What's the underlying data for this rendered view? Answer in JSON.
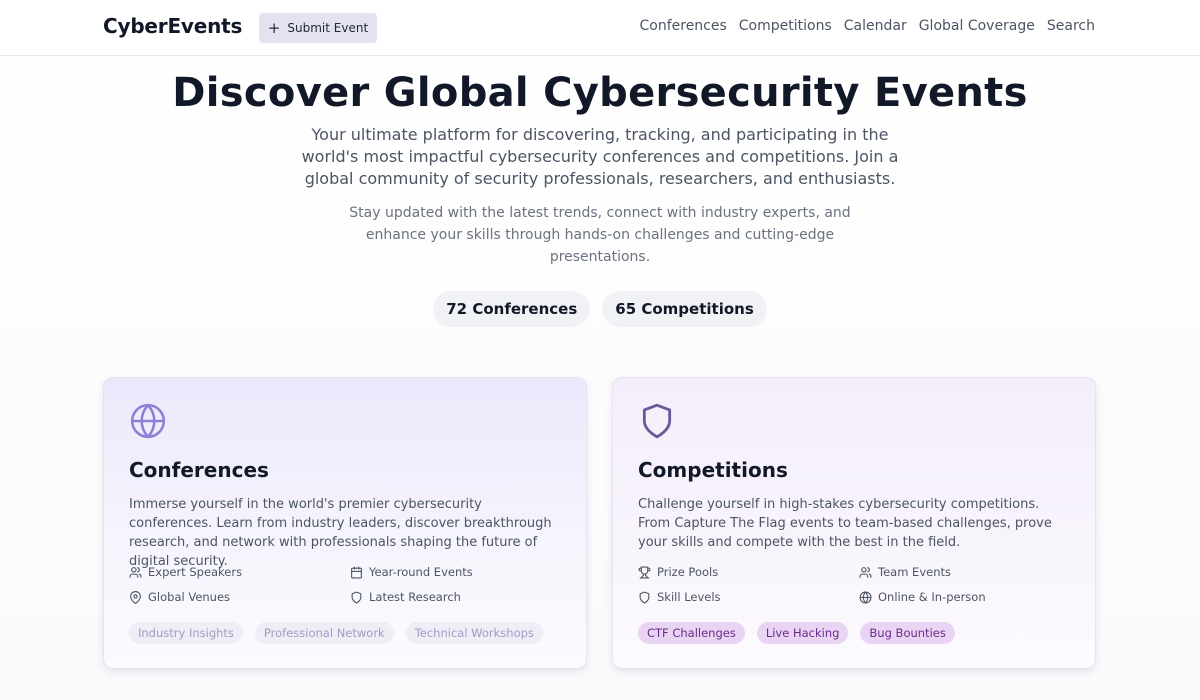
{
  "header": {
    "logo": "CyberEvents",
    "submit_label": "Submit Event",
    "nav": [
      "Conferences",
      "Competitions",
      "Calendar",
      "Global Coverage",
      "Search"
    ]
  },
  "hero": {
    "title": "Discover Global Cybersecurity Events",
    "subtitle": "Your ultimate platform for discovering, tracking, and participating in the world's most impactful cybersecurity conferences and competitions. Join a global community of security professionals, researchers, and enthusiasts.",
    "subtitle2": "Stay updated with the latest trends, connect with industry experts, and enhance your skills through hands-on challenges and cutting-edge presentations.",
    "stats": {
      "conferences": "72 Conferences",
      "competitions": "65 Competitions"
    }
  },
  "cards": {
    "conferences": {
      "icon": "globe-icon",
      "title": "Conferences",
      "description": "Immerse yourself in the world's premier cybersecurity conferences. Learn from industry leaders, discover breakthrough research, and network with professionals shaping the future of digital security.",
      "features": [
        {
          "icon": "users-icon",
          "label": "Expert Speakers"
        },
        {
          "icon": "calendar-icon",
          "label": "Year-round Events"
        },
        {
          "icon": "map-pin-icon",
          "label": "Global Venues"
        },
        {
          "icon": "shield-icon",
          "label": "Latest Research"
        }
      ],
      "tags": [
        "Industry Insights",
        "Professional Network",
        "Technical Workshops"
      ]
    },
    "competitions": {
      "icon": "shield-icon",
      "title": "Competitions",
      "description": "Challenge yourself in high-stakes cybersecurity competitions. From Capture The Flag events to team-based challenges, prove your skills and compete with the best in the field.",
      "features": [
        {
          "icon": "trophy-icon",
          "label": "Prize Pools"
        },
        {
          "icon": "users-icon",
          "label": "Team Events"
        },
        {
          "icon": "shield-icon",
          "label": "Skill Levels"
        },
        {
          "icon": "globe-icon",
          "label": "Online & In-person"
        }
      ],
      "tags": [
        "CTF Challenges",
        "Live Hacking",
        "Bug Bounties"
      ]
    }
  },
  "colors": {
    "accent_purple": "#8b7fd6",
    "shield_purple": "#6b5a9a",
    "tag_comp_bg": "#e9d5f3",
    "tag_comp_text": "#6b2a8a"
  }
}
